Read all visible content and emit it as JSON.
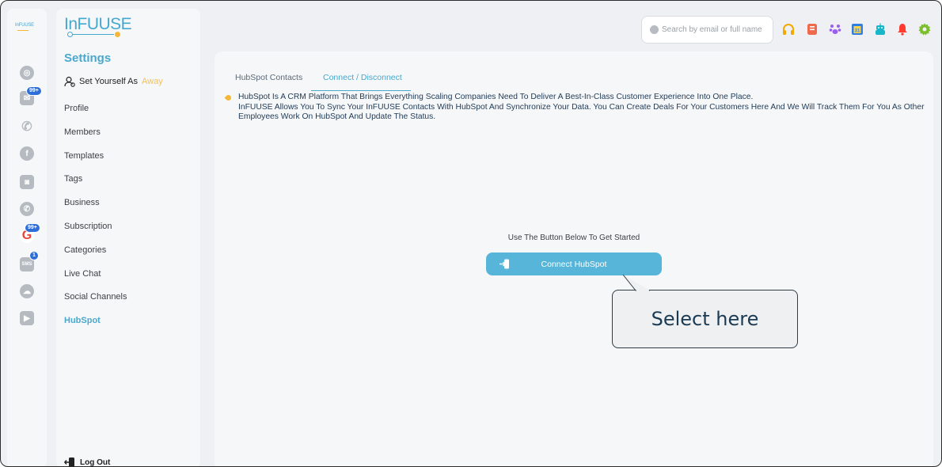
{
  "rail": {
    "logo": "InFUUSE",
    "badges": {
      "email": "99+",
      "google": "99+",
      "sms": "1"
    }
  },
  "sidebar": {
    "logo": "InFUUSE",
    "title": "Settings",
    "away_prefix": "Set Yourself As",
    "away_status": "Away",
    "items": [
      {
        "label": "Profile"
      },
      {
        "label": "Members"
      },
      {
        "label": "Templates"
      },
      {
        "label": "Tags"
      },
      {
        "label": "Business"
      },
      {
        "label": "Subscription"
      },
      {
        "label": "Categories"
      },
      {
        "label": "Live Chat"
      },
      {
        "label": "Social Channels"
      },
      {
        "label": "HubSpot"
      }
    ],
    "active_item": "HubSpot",
    "logout": "Log Out"
  },
  "topbar": {
    "search_placeholder": "Search by email or full name",
    "icons": [
      "headset-icon",
      "notebook-icon",
      "paw-icon",
      "calendar-icon",
      "robot-icon",
      "bell-icon",
      "gear-icon"
    ]
  },
  "main": {
    "tabs": [
      {
        "label": "HubSpot Contacts"
      },
      {
        "label": "Connect / Disconnect"
      }
    ],
    "active_tab": "Connect / Disconnect",
    "info_line1": "HubSpot Is A CRM Platform That Brings Everything Scaling Companies Need To Deliver A Best-In-Class Customer Experience Into One Place.",
    "info_line2": "InFUUSE Allows You To Sync Your InFUUSE Contacts With HubSpot And Synchronize Your Data. You Can Create Deals For Your Customers Here And We Will Track Them For You As Other Employees Work On HubSpot And Update The Status.",
    "hint": "Use The Button Below To Get Started",
    "connect_label": "Connect HubSpot"
  },
  "callout": {
    "text": "Select here"
  },
  "colors": {
    "accent": "#4aa8cd",
    "button": "#56b5d8",
    "away": "#f3c15b"
  }
}
